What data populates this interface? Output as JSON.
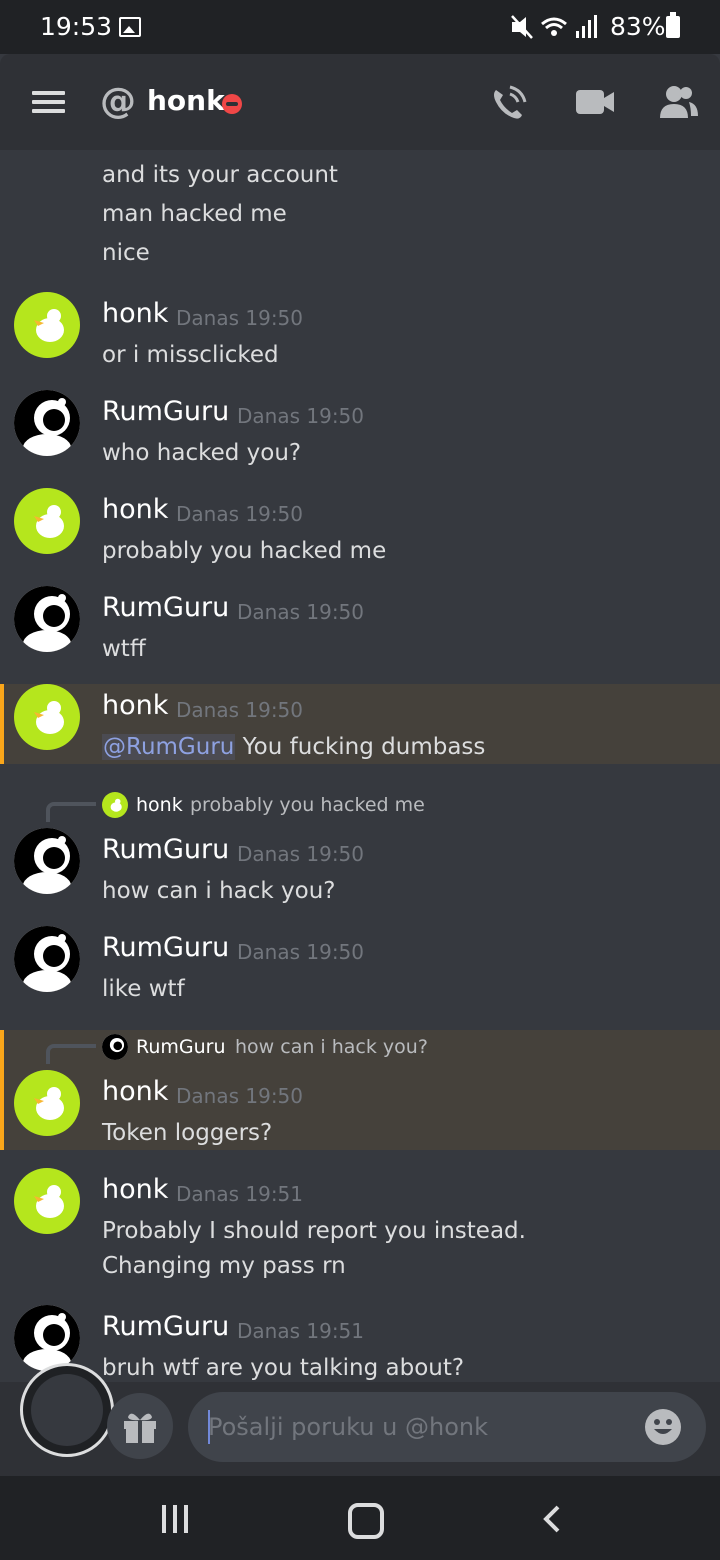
{
  "status_bar": {
    "time": "19:53",
    "battery": "83%"
  },
  "header": {
    "at_symbol": "@",
    "channel": "honk"
  },
  "messages": {
    "top_lines": [
      "and its your account",
      "man hacked me",
      "nice"
    ],
    "groups": [
      {
        "author": "honk",
        "time": "Danas 19:50",
        "lines": [
          "or i missclicked"
        ]
      },
      {
        "author": "RumGuru",
        "time": "Danas 19:50",
        "lines": [
          "who hacked you?"
        ]
      },
      {
        "author": "honk",
        "time": "Danas 19:50",
        "lines": [
          "probably you hacked me"
        ]
      },
      {
        "author": "RumGuru",
        "time": "Danas 19:50",
        "lines": [
          "wtff"
        ]
      },
      {
        "author": "honk",
        "time": "Danas 19:50",
        "mention": "@RumGuru",
        "lines": [
          " You fucking dumbass"
        ]
      },
      {
        "reply_author": "honk",
        "reply_text": "probably you hacked me",
        "author": "RumGuru",
        "time": "Danas 19:50",
        "lines": [
          "how can i hack you?"
        ]
      },
      {
        "author": "RumGuru",
        "time": "Danas 19:50",
        "lines": [
          "like wtf"
        ]
      },
      {
        "reply_author": "RumGuru",
        "reply_text": "how can i hack you?",
        "author": "honk",
        "time": "Danas 19:50",
        "lines": [
          "Token loggers?"
        ]
      },
      {
        "author": "honk",
        "time": "Danas 19:51",
        "lines": [
          "Probably I should report you instead.",
          "Changing my pass rn"
        ]
      },
      {
        "author": "RumGuru",
        "time": "Danas 19:51",
        "lines": [
          "bruh wtf are you talking about?"
        ]
      }
    ]
  },
  "input": {
    "placeholder": "Pošalji poruku u @honk"
  },
  "colors": {
    "accent": "#7289da",
    "mention_bar": "#faa61a",
    "dnd": "#f04747",
    "honk_avatar": "#b5e61d"
  }
}
